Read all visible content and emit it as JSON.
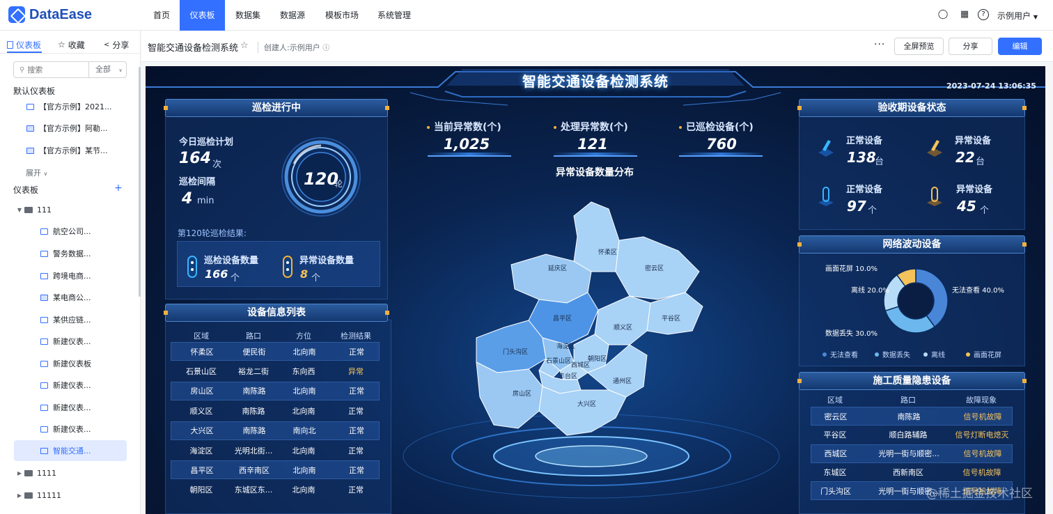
{
  "app": {
    "logo": "DataEase",
    "user": "示例用户"
  },
  "nav": {
    "tabs": [
      "首页",
      "仪表板",
      "数据集",
      "数据源",
      "模板市场",
      "系统管理"
    ],
    "active": "仪表板"
  },
  "sidebar": {
    "tabs": [
      "仪表板",
      "收藏",
      "分享"
    ],
    "search_placeholder": "搜索",
    "search_scope": "全部",
    "default_heading": "默认仪表板",
    "default_items": [
      "【官方示例】2021...",
      "【官方示例】阿勒...",
      "【官方示例】某节..."
    ],
    "expand_label": "展开",
    "dashboards_heading": "仪表板",
    "folder_111": "111",
    "folder_items": [
      "航空公司...",
      "警务数据...",
      "跨境电商...",
      "某电商公...",
      "某供应链...",
      "新建仪表...",
      "新建仪表板",
      "新建仪表...",
      "新建仪表...",
      "新建仪表...",
      "智能交通..."
    ],
    "folder_1111": "1111",
    "folder_11111": "11111"
  },
  "header": {
    "title": "智能交通设备检测系统",
    "creator": "创建人:示例用户",
    "more": "···",
    "fullscreen_label": "全屏预览",
    "share_label": "分享",
    "edit_label": "编辑"
  },
  "dashboard": {
    "title": "智能交通设备检测系统",
    "timestamp": "2023-07-24 13:06:35",
    "patrol": {
      "title": "巡检进行中",
      "plan_label": "今日巡检计划",
      "plan_value": "164",
      "plan_unit": "次",
      "interval_label": "巡检间隔",
      "interval_value": "4",
      "interval_unit": "min",
      "round_value": "120",
      "round_unit": "轮",
      "result_label": "第120轮巡检结果:",
      "checked_label": "巡检设备数量",
      "checked_value": "166",
      "checked_unit": "个",
      "abnormal_label": "异常设备数量",
      "abnormal_value": "8",
      "abnormal_unit": "个"
    },
    "device_table": {
      "title": "设备信息列表",
      "headers": [
        "区域",
        "路口",
        "方位",
        "检测结果"
      ],
      "rows": [
        [
          "怀柔区",
          "便民街",
          "北向南",
          "正常"
        ],
        [
          "石景山区",
          "裕龙二街",
          "东向西",
          "异常"
        ],
        [
          "房山区",
          "南陈路",
          "北向南",
          "正常"
        ],
        [
          "顺义区",
          "南陈路",
          "北向南",
          "正常"
        ],
        [
          "大兴区",
          "南陈路",
          "南向北",
          "正常"
        ],
        [
          "海淀区",
          "光明北街...",
          "北向南",
          "正常"
        ],
        [
          "昌平区",
          "西辛南区",
          "北向南",
          "正常"
        ],
        [
          "朝阳区",
          "东城区东...",
          "北向南",
          "正常"
        ]
      ]
    },
    "kpis": [
      {
        "label": "当前异常数(个)",
        "value": "1,025"
      },
      {
        "label": "处理异常数(个)",
        "value": "121"
      },
      {
        "label": "已巡检设备(个)",
        "value": "760"
      }
    ],
    "map": {
      "title": "异常设备数量分布",
      "districts": [
        "延庆区",
        "怀柔区",
        "密云区",
        "昌平区",
        "顺义区",
        "平谷区",
        "门头沟区",
        "海淀区",
        "石景山区",
        "朝阳区",
        "西城区",
        "丰台区",
        "通州区",
        "房山区",
        "大兴区"
      ]
    },
    "status": {
      "title": "验收期设备状态",
      "items": [
        {
          "label": "正常设备",
          "value": "138",
          "unit": "台"
        },
        {
          "label": "异常设备",
          "value": "22",
          "unit": "台"
        },
        {
          "label": "正常设备",
          "value": "97",
          "unit": "个"
        },
        {
          "label": "异常设备",
          "value": "45",
          "unit": "个"
        }
      ]
    },
    "network": {
      "title": "网络波动设备",
      "chart_data": {
        "type": "pie",
        "categories": [
          "无法查看",
          "数据丢失",
          "离线",
          "画面花屏"
        ],
        "values": [
          40.0,
          30.0,
          20.0,
          10.0
        ],
        "labels": [
          "无法查看 40.0%",
          "数据丢失 30.0%",
          "离线 20.0%",
          "画面花屏 10.0%"
        ],
        "colors": [
          "#4a86d8",
          "#6cb8ee",
          "#b7dcf7",
          "#f4c25a"
        ],
        "legend": "bottom"
      }
    },
    "quality": {
      "title": "施工质量隐患设备",
      "headers": [
        "区域",
        "路口",
        "故障现象"
      ],
      "rows": [
        [
          "密云区",
          "南陈路",
          "信号机故障"
        ],
        [
          "平谷区",
          "顺白路辅路",
          "信号灯断电熄灭"
        ],
        [
          "西城区",
          "光明一街与顺密...",
          "信号机故障"
        ],
        [
          "东城区",
          "西新南区",
          "信号机故障"
        ],
        [
          "门头沟区",
          "光明一街与顺密...",
          "信号机故障"
        ]
      ]
    }
  },
  "watermark": "@稀土掘金技术社区"
}
